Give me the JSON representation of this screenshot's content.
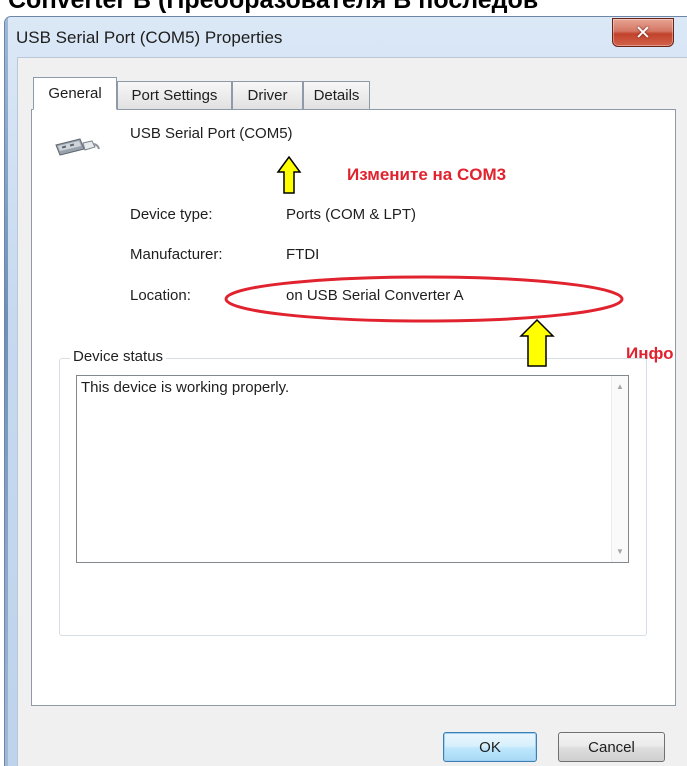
{
  "page": {
    "heading": "Converter B (Преобразователя В последов"
  },
  "window": {
    "title": "USB Serial Port (COM5) Properties",
    "close_icon": "close-icon"
  },
  "tabs": [
    {
      "label": "General",
      "active": true
    },
    {
      "label": "Port Settings",
      "active": false
    },
    {
      "label": "Driver",
      "active": false
    },
    {
      "label": "Details",
      "active": false
    }
  ],
  "general": {
    "device_icon": "usb-connector-icon",
    "device_name": "USB Serial Port (COM5)",
    "properties": [
      {
        "label": "Device type:",
        "value": "Ports (COM & LPT)"
      },
      {
        "label": "Manufacturer:",
        "value": "FTDI"
      },
      {
        "label": "Location:",
        "value": "on USB Serial Converter A"
      }
    ],
    "status_legend": "Device status",
    "status_text": "This device is working properly."
  },
  "annotations": {
    "change_label": "Измените на COM3",
    "info_label": "Инфо",
    "color": "#e0232e",
    "arrow_color": "#ffff00"
  },
  "buttons": {
    "ok": "OK",
    "cancel": "Cancel"
  }
}
